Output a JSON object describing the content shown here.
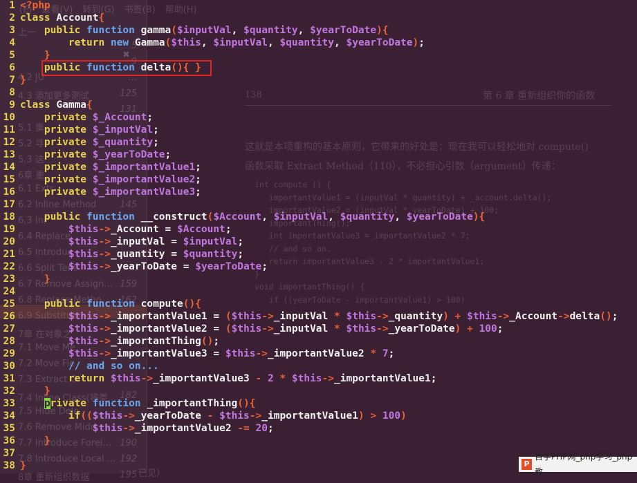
{
  "background": {
    "menu": [
      "(E)",
      "查看(V)",
      "转到(G)",
      "书签(B)",
      "帮助(H)"
    ],
    "outline": [
      {
        "label": "上一",
        "page": ""
      },
      {
        "label": "",
        "page": "5"
      },
      {
        "label": "",
        "page": "9"
      },
      {
        "label": "4.2 JU",
        "page": "..."
      },
      {
        "label": "4.3 添加更多测试",
        "page": "125"
      },
      {
        "label": "",
        "page": "131"
      },
      {
        "label": "5.1 重",
        "page": ""
      },
      {
        "label": "5.2 寻",
        "page": ""
      },
      {
        "label": "5.3 这",
        "page": ""
      },
      {
        "label": "6章 重",
        "page": ""
      },
      {
        "label": "6.1 Extr",
        "page": ""
      },
      {
        "label": "6.2 Inline Method",
        "page": "145"
      },
      {
        "label": "6.3 Inl",
        "page": ""
      },
      {
        "label": "6.4 Replace",
        "page": ""
      },
      {
        "label": "6.5 Introduc",
        "page": ""
      },
      {
        "label": "6.6 Split Tem",
        "page": ""
      },
      {
        "label": "6.7 Remove Assign...",
        "page": "159"
      },
      {
        "label": "6.8 Replace Metho...",
        "page": "162"
      },
      {
        "label": "6.9 Substitut",
        "page": ""
      },
      {
        "label": "7章 在对象之",
        "page": ""
      },
      {
        "label": "7.1 Move Me",
        "page": ""
      },
      {
        "label": "7.2 Move Fie",
        "page": ""
      },
      {
        "label": "7.3 Extract C",
        "page": ""
      },
      {
        "label": "7.4 Inline Class(将类...",
        "page": "182"
      },
      {
        "label": "7.5 Hide Dele",
        "page": ""
      },
      {
        "label": "7.6 Remove Midd",
        "page": ""
      },
      {
        "label": "7.7 Introduce Forei...",
        "page": "190"
      },
      {
        "label": "7.8 Introduce Local ...",
        "page": "192"
      },
      {
        "label": "8章 重新组织数据",
        "page": "195"
      }
    ],
    "book": {
      "page_no": "138",
      "chapter": "第 6 章   重新组织你的函数",
      "para1": "这就是本项重构的基本原则，它带来的好处是：现在我可以轻松地对 compute()",
      "para2": "函数采取 Extract Method（110），不必担心引数（argument）传递：",
      "code": [
        "int compute () {",
        "   importantValue1 = (inputVal * quantity) + _account.delta();",
        "   importantValue2 = (inputVal * yearToDate) + 100;",
        "   importantThing();",
        "   int importantValue3 = importantValue2 * 7;",
        "   // and so on.",
        "   return importantValue3 - 2 * importantValue1;",
        "}",
        "void importantThing() {",
        "   if ((yearToDate - importantValue1) > 100)"
      ],
      "footer": "已见）"
    }
  },
  "editor": {
    "lines": [
      {
        "n": "1",
        "c": [
          [
            "br",
            "<?php"
          ]
        ]
      },
      {
        "n": "2",
        "c": [
          [
            "kw",
            "class "
          ],
          [
            "",
            "Account"
          ],
          [
            "br",
            "{"
          ]
        ]
      },
      {
        "n": "3",
        "c": [
          [
            "",
            "    "
          ],
          [
            "kw",
            "public "
          ],
          [
            "kw2",
            "function "
          ],
          [
            "",
            "gamma"
          ],
          [
            "br",
            "("
          ],
          [
            "var",
            "$inputVal"
          ],
          [
            "",
            ", "
          ],
          [
            "var",
            "$quantity"
          ],
          [
            "",
            ", "
          ],
          [
            "var",
            "$yearToDate"
          ],
          [
            "br",
            "){"
          ]
        ]
      },
      {
        "n": "4",
        "c": [
          [
            "",
            "        "
          ],
          [
            "kw",
            "return "
          ],
          [
            "kw2",
            "new "
          ],
          [
            "",
            "Gamma"
          ],
          [
            "br",
            "("
          ],
          [
            "var",
            "$this"
          ],
          [
            "",
            ", "
          ],
          [
            "var",
            "$inputVal"
          ],
          [
            "",
            ", "
          ],
          [
            "var",
            "$quantity"
          ],
          [
            "",
            ", "
          ],
          [
            "var",
            "$yearToDate"
          ],
          [
            "br",
            ")"
          ],
          [
            "",
            ";"
          ]
        ]
      },
      {
        "n": "5",
        "c": [
          [
            "",
            "    "
          ],
          [
            "br",
            "}"
          ]
        ]
      },
      {
        "n": "6",
        "c": [
          [
            "",
            "    "
          ],
          [
            "kw",
            "public "
          ],
          [
            "kw2",
            "function "
          ],
          [
            "",
            "delta"
          ],
          [
            "br",
            "(){ }"
          ]
        ]
      },
      {
        "n": "7",
        "c": [
          [
            "br",
            "}"
          ]
        ]
      },
      {
        "n": "8",
        "c": []
      },
      {
        "n": "9",
        "c": [
          [
            "kw",
            "class "
          ],
          [
            "",
            "Gamma"
          ],
          [
            "br",
            "{"
          ]
        ]
      },
      {
        "n": "10",
        "c": [
          [
            "",
            "    "
          ],
          [
            "kw",
            "private "
          ],
          [
            "var",
            "$_Account"
          ],
          [
            "",
            ";"
          ]
        ]
      },
      {
        "n": "11",
        "c": [
          [
            "",
            "    "
          ],
          [
            "kw",
            "private "
          ],
          [
            "var",
            "$_inputVal"
          ],
          [
            "",
            ";"
          ]
        ]
      },
      {
        "n": "12",
        "c": [
          [
            "",
            "    "
          ],
          [
            "kw",
            "private "
          ],
          [
            "var",
            "$_quantity"
          ],
          [
            "",
            ";"
          ]
        ]
      },
      {
        "n": "13",
        "c": [
          [
            "",
            "    "
          ],
          [
            "kw",
            "private "
          ],
          [
            "var",
            "$_yearToDate"
          ],
          [
            "",
            ";"
          ]
        ]
      },
      {
        "n": "14",
        "c": [
          [
            "",
            "    "
          ],
          [
            "kw",
            "private "
          ],
          [
            "var",
            "$_importantValue1"
          ],
          [
            "",
            ";"
          ]
        ]
      },
      {
        "n": "15",
        "c": [
          [
            "",
            "    "
          ],
          [
            "kw",
            "private "
          ],
          [
            "var",
            "$_importantValue2"
          ],
          [
            "",
            ";"
          ]
        ]
      },
      {
        "n": "16",
        "c": [
          [
            "",
            "    "
          ],
          [
            "kw",
            "private "
          ],
          [
            "var",
            "$_importantValue3"
          ],
          [
            "",
            ";"
          ]
        ]
      },
      {
        "n": "17",
        "c": []
      },
      {
        "n": "18",
        "c": [
          [
            "",
            "    "
          ],
          [
            "kw",
            "public "
          ],
          [
            "kw2",
            "function "
          ],
          [
            "",
            "__construct"
          ],
          [
            "br",
            "("
          ],
          [
            "var",
            "$Account"
          ],
          [
            "",
            ", "
          ],
          [
            "var",
            "$inputVal"
          ],
          [
            "",
            ", "
          ],
          [
            "var",
            "$quantity"
          ],
          [
            "",
            ", "
          ],
          [
            "var",
            "$yearToDate"
          ],
          [
            "br",
            "){"
          ]
        ]
      },
      {
        "n": "19",
        "c": [
          [
            "",
            "        "
          ],
          [
            "var",
            "$this"
          ],
          [
            "arr",
            "->"
          ],
          [
            "",
            "_Account = "
          ],
          [
            "var",
            "$Account"
          ],
          [
            "",
            ";"
          ]
        ]
      },
      {
        "n": "20",
        "c": [
          [
            "",
            "        "
          ],
          [
            "var",
            "$this"
          ],
          [
            "arr",
            "->"
          ],
          [
            "",
            "_inputVal = "
          ],
          [
            "var",
            "$inputVal"
          ],
          [
            "",
            ";"
          ]
        ]
      },
      {
        "n": "21",
        "c": [
          [
            "",
            "        "
          ],
          [
            "var",
            "$this"
          ],
          [
            "arr",
            "->"
          ],
          [
            "",
            "_quantity = "
          ],
          [
            "var",
            "$quantity"
          ],
          [
            "",
            ";"
          ]
        ]
      },
      {
        "n": "22",
        "c": [
          [
            "",
            "        "
          ],
          [
            "var",
            "$this"
          ],
          [
            "arr",
            "->"
          ],
          [
            "",
            "_yearToDate = "
          ],
          [
            "var",
            "$yearToDate"
          ],
          [
            "",
            ";"
          ]
        ]
      },
      {
        "n": "23",
        "c": [
          [
            "",
            "    "
          ],
          [
            "br",
            "}"
          ]
        ]
      },
      {
        "n": "24",
        "c": []
      },
      {
        "n": "25",
        "c": [
          [
            "",
            "    "
          ],
          [
            "kw",
            "public "
          ],
          [
            "kw2",
            "function "
          ],
          [
            "",
            "compute"
          ],
          [
            "br",
            "(){"
          ]
        ]
      },
      {
        "n": "26",
        "c": [
          [
            "",
            "        "
          ],
          [
            "var",
            "$this"
          ],
          [
            "arr",
            "->"
          ],
          [
            "",
            "_importantValue1 = "
          ],
          [
            "br",
            "("
          ],
          [
            "var",
            "$this"
          ],
          [
            "arr",
            "->"
          ],
          [
            "",
            "_inputVal "
          ],
          [
            "arr",
            "*"
          ],
          [
            "var",
            " $this"
          ],
          [
            "arr",
            "->"
          ],
          [
            "",
            "_quantity"
          ],
          [
            "br",
            ")"
          ],
          [
            "arr",
            " + "
          ],
          [
            "var",
            "$this"
          ],
          [
            "arr",
            "->"
          ],
          [
            "",
            "_Account"
          ],
          [
            "arr",
            "->"
          ],
          [
            "",
            "delta"
          ],
          [
            "br",
            "()"
          ],
          [
            "",
            ";"
          ]
        ]
      },
      {
        "n": "27",
        "c": [
          [
            "",
            "        "
          ],
          [
            "var",
            "$this"
          ],
          [
            "arr",
            "->"
          ],
          [
            "",
            "_importantValue2 = "
          ],
          [
            "br",
            "("
          ],
          [
            "var",
            "$this"
          ],
          [
            "arr",
            "->"
          ],
          [
            "",
            "_inputVal "
          ],
          [
            "arr",
            "*"
          ],
          [
            "var",
            " $this"
          ],
          [
            "arr",
            "->"
          ],
          [
            "",
            "_yearToDate"
          ],
          [
            "br",
            ")"
          ],
          [
            "arr",
            " + "
          ],
          [
            "num",
            "100"
          ],
          [
            "",
            ";"
          ]
        ]
      },
      {
        "n": "28",
        "c": [
          [
            "",
            "        "
          ],
          [
            "var",
            "$this"
          ],
          [
            "arr",
            "->"
          ],
          [
            "",
            "_importantThing"
          ],
          [
            "br",
            "()"
          ],
          [
            "",
            ";"
          ]
        ]
      },
      {
        "n": "29",
        "c": [
          [
            "",
            "        "
          ],
          [
            "var",
            "$this"
          ],
          [
            "arr",
            "->"
          ],
          [
            "",
            "_importantValue3 = "
          ],
          [
            "var",
            "$this"
          ],
          [
            "arr",
            "->"
          ],
          [
            "",
            "_importantValue2 "
          ],
          [
            "arr",
            "*"
          ],
          [
            "num",
            " 7"
          ],
          [
            "",
            ";"
          ]
        ]
      },
      {
        "n": "30",
        "c": [
          [
            "",
            "        "
          ],
          [
            "com",
            "// and so on..."
          ]
        ]
      },
      {
        "n": "31",
        "c": [
          [
            "",
            "        "
          ],
          [
            "kw",
            "return "
          ],
          [
            "var",
            "$this"
          ],
          [
            "arr",
            "->"
          ],
          [
            "",
            "_importantValue3 "
          ],
          [
            "arr",
            "- "
          ],
          [
            "num",
            "2"
          ],
          [
            "arr",
            " * "
          ],
          [
            "var",
            "$this"
          ],
          [
            "arr",
            "->"
          ],
          [
            "",
            "_importantValue1;"
          ]
        ]
      },
      {
        "n": "32",
        "c": [
          [
            "",
            "    "
          ],
          [
            "br",
            "}"
          ]
        ]
      },
      {
        "n": "33",
        "c": [
          [
            "",
            "    "
          ],
          [
            "cur",
            "p"
          ],
          [
            "kw",
            "rivate "
          ],
          [
            "kw2",
            "function "
          ],
          [
            "",
            "_importantThing"
          ],
          [
            "br",
            "(){"
          ]
        ]
      },
      {
        "n": "34",
        "c": [
          [
            "",
            "        "
          ],
          [
            "kw",
            "if"
          ],
          [
            "br",
            "(("
          ],
          [
            "var",
            "$this"
          ],
          [
            "arr",
            "->"
          ],
          [
            "",
            "_yearToDate "
          ],
          [
            "arr",
            "-"
          ],
          [
            "var",
            " $this"
          ],
          [
            "arr",
            "->"
          ],
          [
            "",
            "_importantValue1"
          ],
          [
            "br",
            ")"
          ],
          [
            "arr",
            " > "
          ],
          [
            "num",
            "100"
          ],
          [
            "br",
            ")"
          ]
        ]
      },
      {
        "n": "35",
        "c": [
          [
            "",
            "            "
          ],
          [
            "var",
            "$this"
          ],
          [
            "arr",
            "->"
          ],
          [
            "",
            "_importantValue2 "
          ],
          [
            "arr",
            "-="
          ],
          [
            "num",
            " 20"
          ],
          [
            "",
            ";"
          ]
        ]
      },
      {
        "n": "36",
        "c": [
          [
            "",
            "    "
          ],
          [
            "br",
            "}"
          ]
        ]
      },
      {
        "n": "37",
        "c": []
      },
      {
        "n": "38",
        "c": [
          [
            "br",
            "}"
          ]
        ]
      }
    ]
  },
  "colors": {
    "background": "#3b2033",
    "keyword": "#e8d14f",
    "function_keyword": "#6aa7ee",
    "variable": "#c277e0",
    "bracket": "#ee6432",
    "highlight_box": "#e02525",
    "cursor": "#7bd73a"
  },
  "watermark": {
    "text": "自学PHP网_php学习_php教"
  }
}
